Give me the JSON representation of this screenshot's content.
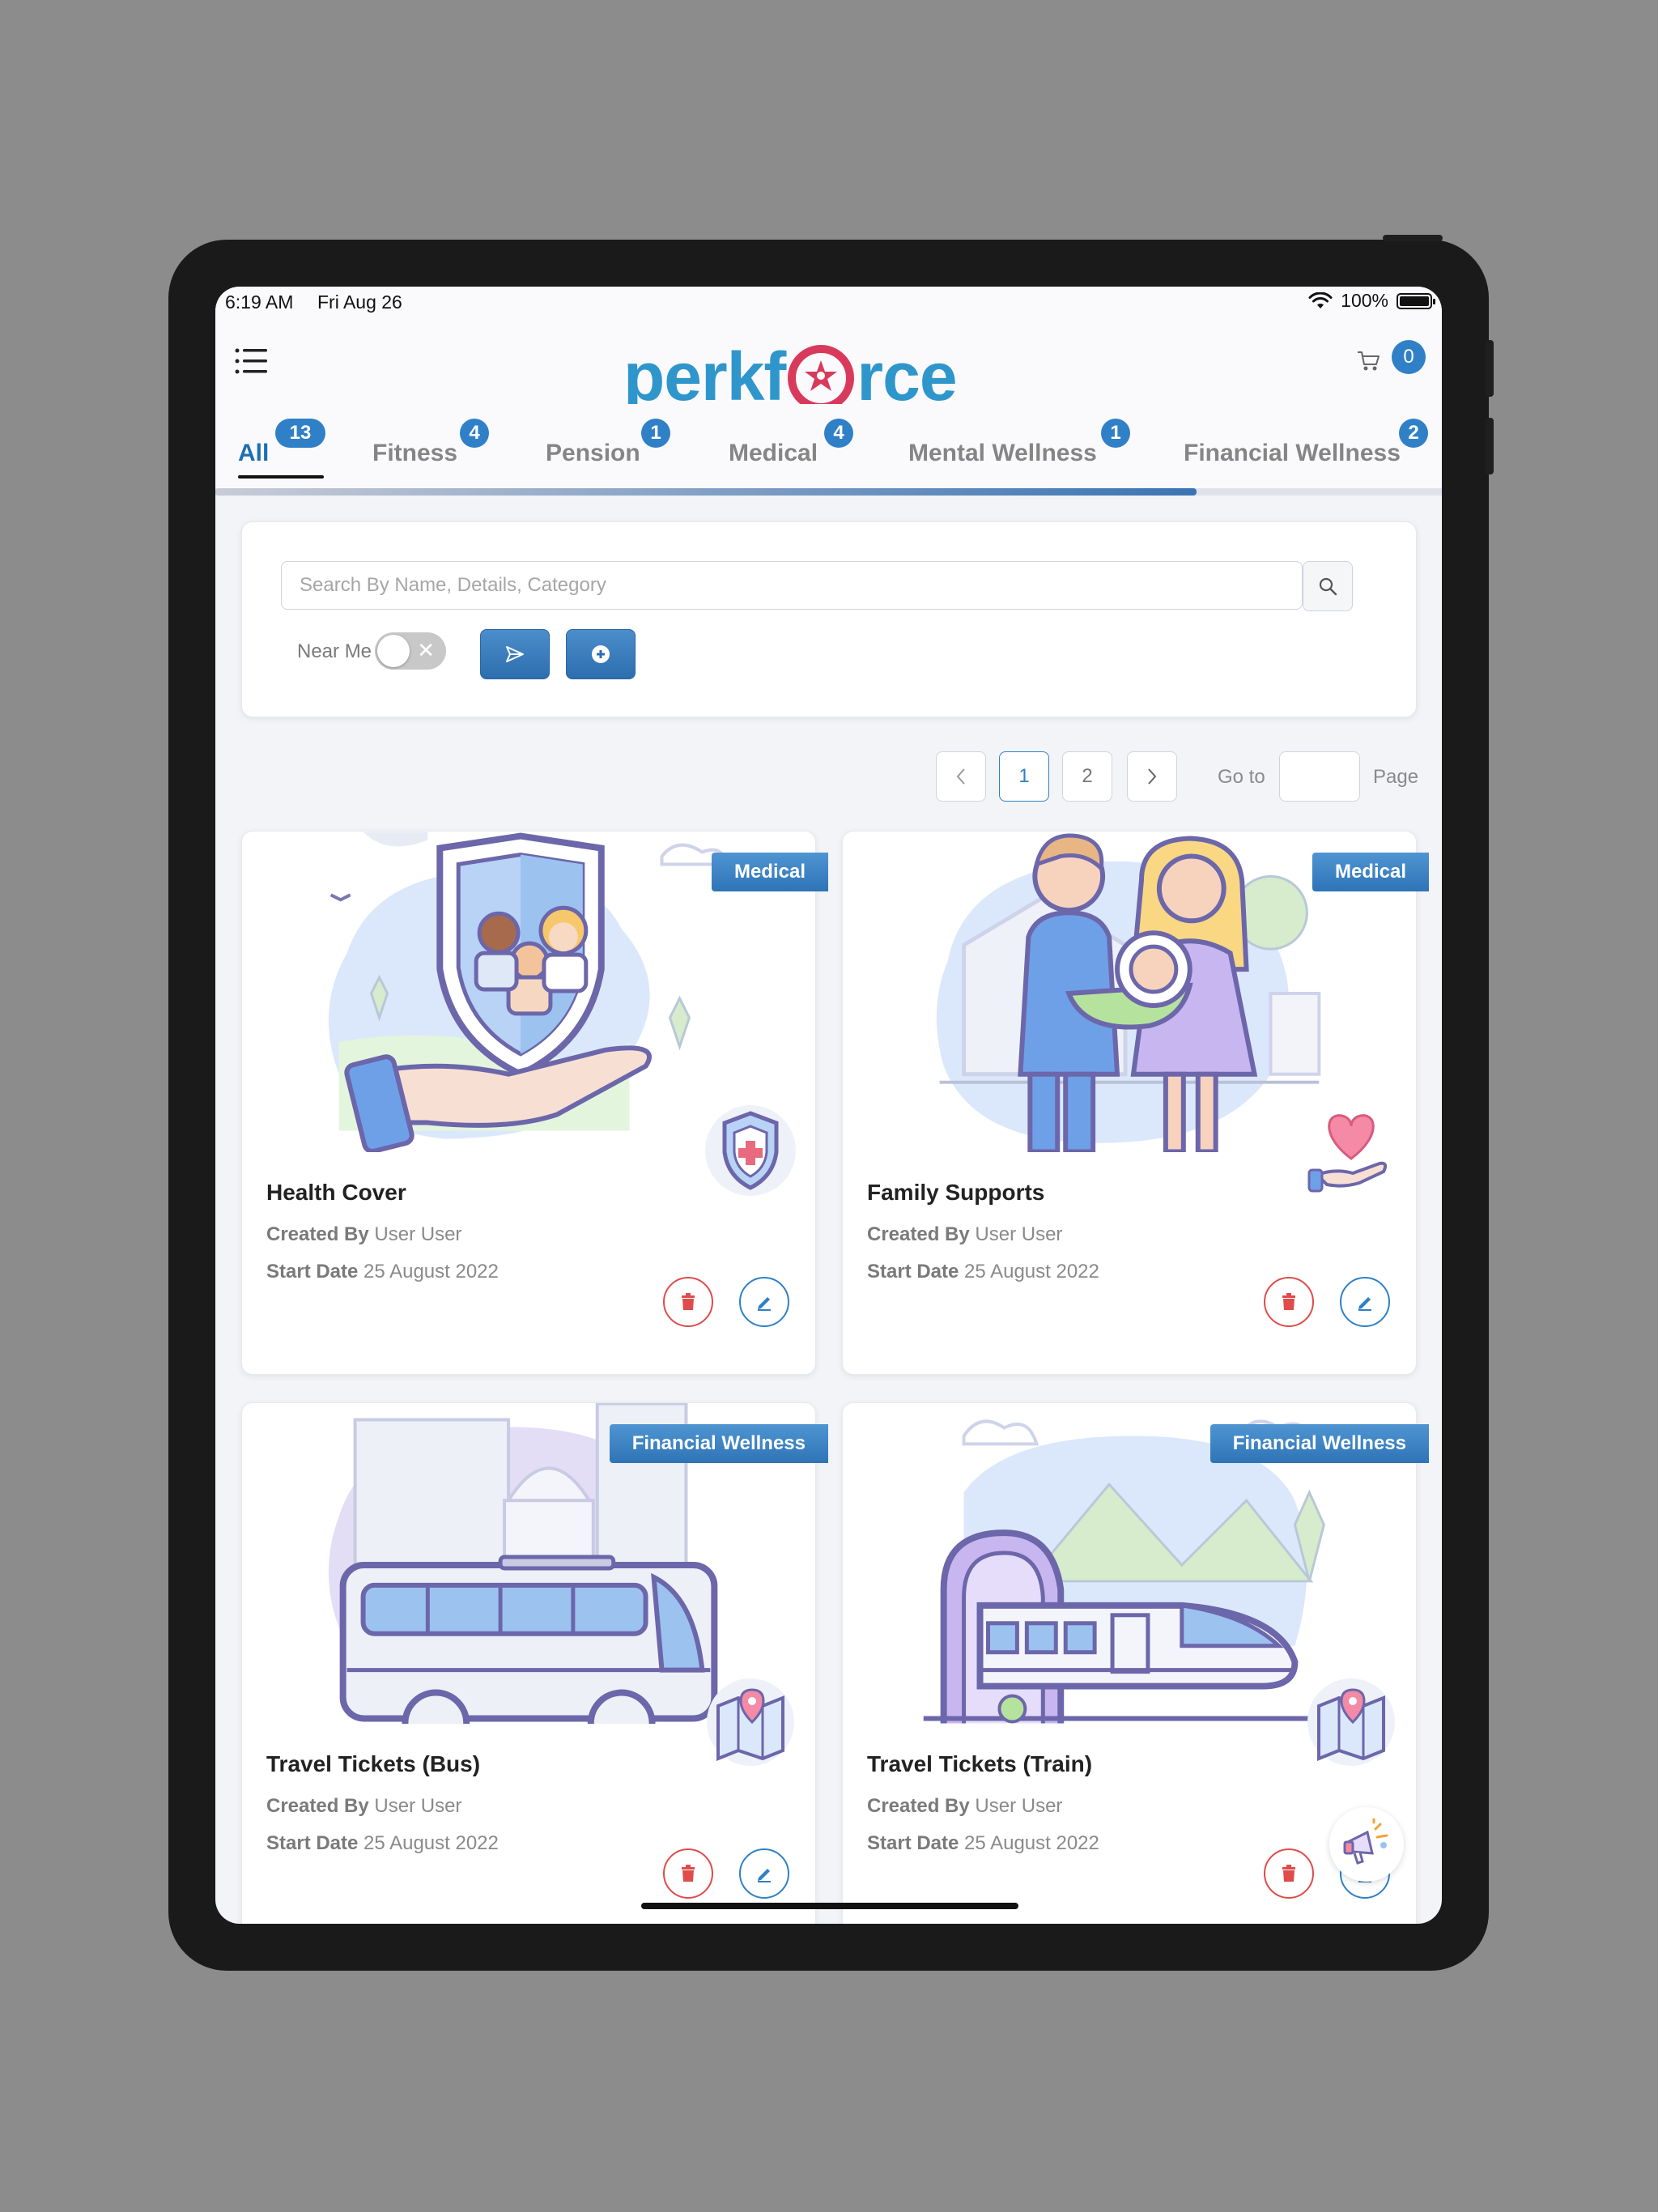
{
  "status_bar": {
    "time": "6:19 AM",
    "date": "Fri Aug 26",
    "battery": "100%"
  },
  "header": {
    "logo_left": "perkf",
    "logo_right": "rce",
    "cart_count": "0"
  },
  "tabs": [
    {
      "label": "All",
      "count": "13",
      "active": true
    },
    {
      "label": "Fitness",
      "count": "4"
    },
    {
      "label": "Pension",
      "count": "1"
    },
    {
      "label": "Medical",
      "count": "4"
    },
    {
      "label": "Mental Wellness",
      "count": "1"
    },
    {
      "label": "Financial Wellness",
      "count": "2"
    }
  ],
  "search": {
    "placeholder": "Search By Name, Details, Category",
    "near_me_label": "Near Me",
    "near_me_enabled": false
  },
  "pagination": {
    "pages": [
      "1",
      "2"
    ],
    "current": "1",
    "goto_label": "Go to",
    "page_label": "Page"
  },
  "cards": [
    {
      "category": "Medical",
      "title": "Health Cover",
      "created_by_label": "Created By",
      "created_by": "User User",
      "start_date_label": "Start Date",
      "start_date": "25 August 2022"
    },
    {
      "category": "Medical",
      "title": "Family Supports",
      "created_by_label": "Created By",
      "created_by": "User User",
      "start_date_label": "Start Date",
      "start_date": "25 August 2022"
    },
    {
      "category": "Financial Wellness",
      "title": "Travel Tickets (Bus)",
      "created_by_label": "Created By",
      "created_by": "User User",
      "start_date_label": "Start Date",
      "start_date": "25 August 2022"
    },
    {
      "category": "Financial Wellness",
      "title": "Travel Tickets (Train)",
      "created_by_label": "Created By",
      "created_by": "User User",
      "start_date_label": "Start Date",
      "start_date": "25 August 2022"
    }
  ],
  "colors": {
    "brand_blue": "#2f96cc",
    "brand_red": "#d93a5b",
    "accent": "#2f80c7",
    "delete": "#e04b4b"
  }
}
